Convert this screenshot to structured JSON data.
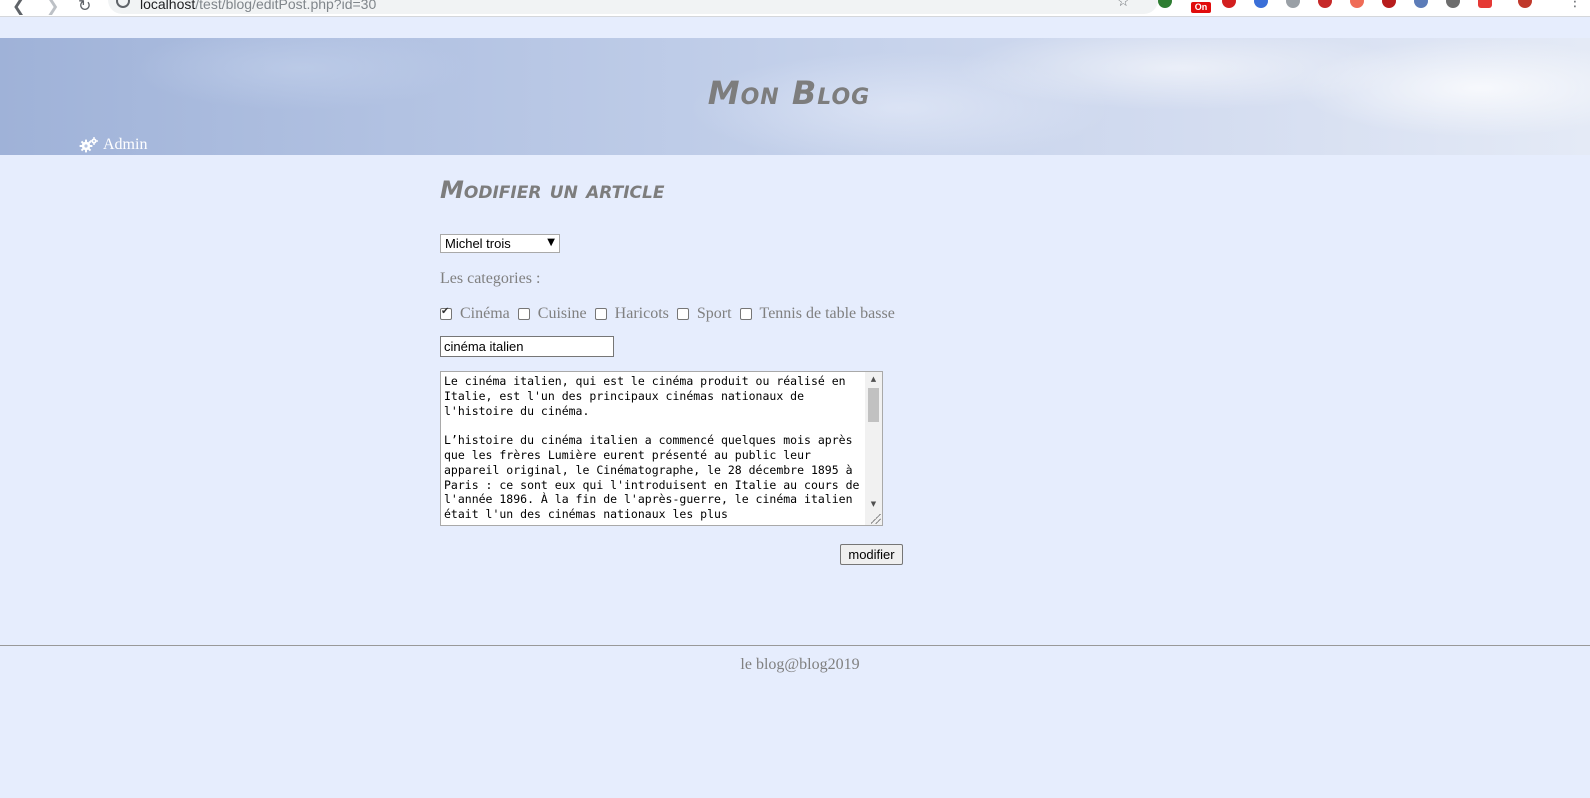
{
  "browser": {
    "url_host": "localhost",
    "url_path": "/test/blog/editPost.php?id=30",
    "extension_badge": "On"
  },
  "header": {
    "site_title": "Mon Blog",
    "admin_label": "Admin"
  },
  "form": {
    "heading": "Modifier un article",
    "author_selected": "Michel trois",
    "categories_label": "Les categories :",
    "categories": [
      {
        "label": "Cinéma",
        "checked": true
      },
      {
        "label": "Cuisine",
        "checked": false
      },
      {
        "label": "Haricots",
        "checked": false
      },
      {
        "label": "Sport",
        "checked": false
      },
      {
        "label": "Tennis de table basse",
        "checked": false
      }
    ],
    "title_value": "cinéma italien",
    "content": "Le cinéma italien, qui est le cinéma produit ou réalisé en Italie, est l'un des principaux cinémas nationaux de l'histoire du cinéma.\n\nL’histoire du cinéma italien a commencé quelques mois après que les frères Lumière eurent présenté au public leur appareil original, le Cinématographe, le 28 décembre 1895 à Paris : ce sont eux qui l'introduisent en Italie au cours de l'année 1896. À la fin de l'après-guerre, le cinéma italien était l'un des cinémas nationaux les plus",
    "submit_label": "modifier"
  },
  "footer": {
    "text": "le blog@blog2019"
  },
  "colors": {
    "page_background": "#e6edfd",
    "title_gray": "#7d7d7d",
    "text_gray": "#808080"
  }
}
